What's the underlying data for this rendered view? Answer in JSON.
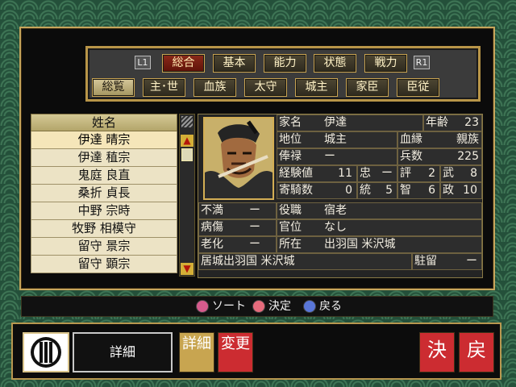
{
  "buttons": {
    "l1": "L1",
    "r1": "R1"
  },
  "tabs_top": [
    "総合",
    "基本",
    "能力",
    "状態",
    "戦力"
  ],
  "tabs_bottom": [
    "総覧",
    "主･世",
    "血族",
    "太守",
    "城主",
    "家臣",
    "臣従"
  ],
  "list": {
    "header": "姓名",
    "items": [
      "伊達 晴宗",
      "伊達 稙宗",
      "鬼庭 良直",
      "桑折 貞長",
      "中野 宗時",
      "牧野 相模守",
      "留守 景宗",
      "留守 顕宗"
    ],
    "selected_index": 0
  },
  "detail": {
    "family_label": "家名",
    "family_value": "伊達",
    "age_label": "年齢",
    "age_value": "23",
    "rank_label": "地位",
    "rank_value": "城主",
    "blood_label": "血縁",
    "blood_value": "親族",
    "stipend_label": "俸禄",
    "stipend_value": "ー",
    "troops_label": "兵数",
    "troops_value": "225",
    "exp_label": "経験値",
    "exp_value": "11",
    "loyalty_label": "忠",
    "loyalty_value": "ー",
    "fame_label": "評",
    "fame_value": "2",
    "war_label": "武",
    "war_value": "8",
    "cav_label": "寄騎数",
    "cav_value": "0",
    "lead_label": "統",
    "lead_value": "5",
    "int_label": "智",
    "int_value": "6",
    "pol_label": "政",
    "pol_value": "10",
    "discontent_label": "不満",
    "discontent_value": "ー",
    "role_label": "役職",
    "role_value": "宿老",
    "illness_label": "病傷",
    "illness_value": "ー",
    "court_label": "官位",
    "court_value": "なし",
    "aging_label": "老化",
    "aging_value": "ー",
    "location_label": "所在",
    "location_value": "出羽国 米沢城",
    "castle_label": "居城",
    "castle_value": "出羽国 米沢城",
    "station_label": "駐留",
    "station_value": "ー"
  },
  "commands": {
    "sort": "ソート",
    "confirm": "決定",
    "back": "戻る"
  },
  "bottom": {
    "detail_text": "詳細",
    "detail_btn": "詳細",
    "change_btn": "変更",
    "decide_btn": "決",
    "return_btn": "戻"
  },
  "colors": {
    "gold": "#c9a452",
    "red_tab": "#8b2a1a",
    "square_btn": "#cc2c31",
    "circle_btn": "#dc4f73",
    "cross_btn": "#4b63cf"
  }
}
